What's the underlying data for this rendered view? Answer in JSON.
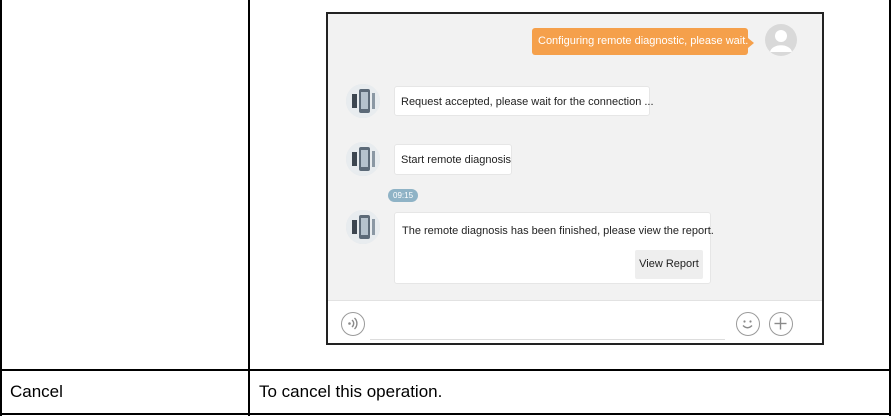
{
  "chat": {
    "outgoing_message": "Configuring remote diagnostic, please wait...",
    "messages": [
      "Request accepted, please wait for the connection ...",
      "Start remote diagnosis",
      "The remote diagnosis has been finished, please view the report."
    ],
    "timestamp": "09:15",
    "view_report_label": "View Report",
    "icons": [
      "voice-icon",
      "emoji-icon",
      "plus-icon",
      "user-avatar-icon"
    ],
    "colors": {
      "outgoing_bubble": "#f5a04b",
      "time_pill": "#8fb3c6",
      "chat_background": "#f2f2f2"
    }
  },
  "table": {
    "row2": {
      "term": "Cancel",
      "description": "To cancel this operation."
    }
  }
}
